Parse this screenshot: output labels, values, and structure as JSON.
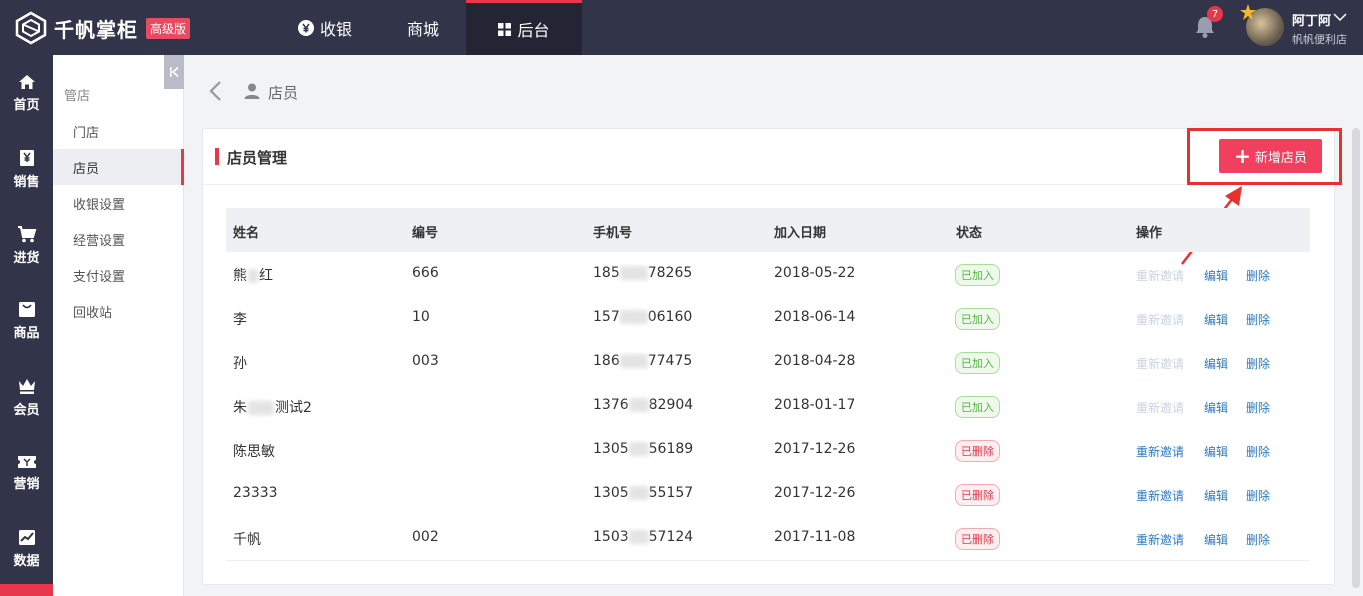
{
  "app": {
    "name": "千帆掌柜",
    "edition_badge": "高级版"
  },
  "topnav": [
    {
      "label": "收银",
      "icon": "yen-coin-icon"
    },
    {
      "label": "商城",
      "icon": ""
    },
    {
      "label": "后台",
      "icon": "grid-icon",
      "active": true
    }
  ],
  "header": {
    "notification_count": "7",
    "user_name": "阿丁阿",
    "store_name": "帆帆便利店"
  },
  "leftnav": [
    {
      "label": "首页",
      "icon": "home-icon"
    },
    {
      "label": "销售",
      "icon": "sales-receipt-icon"
    },
    {
      "label": "进货",
      "icon": "cart-icon"
    },
    {
      "label": "商品",
      "icon": "goods-box-icon"
    },
    {
      "label": "会员",
      "icon": "crown-icon"
    },
    {
      "label": "营销",
      "icon": "ticket-icon"
    },
    {
      "label": "数据",
      "icon": "chart-icon"
    }
  ],
  "subnav": {
    "title": "管店",
    "items": [
      {
        "label": "门店"
      },
      {
        "label": "店员",
        "active": true
      },
      {
        "label": "收银设置"
      },
      {
        "label": "经营设置"
      },
      {
        "label": "支付设置"
      },
      {
        "label": "回收站"
      }
    ]
  },
  "breadcrumb": {
    "label": "店员"
  },
  "card": {
    "title": "店员管理",
    "add_button": "新增店员"
  },
  "table": {
    "columns": [
      "姓名",
      "编号",
      "手机号",
      "加入日期",
      "状态",
      "操作"
    ],
    "rows": [
      {
        "name_pre": "熊",
        "name_post": "红",
        "id": "666",
        "phone_pre": "185",
        "phone_post": "78265",
        "date": "2018-05-22",
        "status": "已加入",
        "status_type": "ok",
        "actions": [
          "重新邀请",
          "编辑",
          "删除"
        ],
        "reinvite_enabled": false
      },
      {
        "name_pre": "李",
        "name_post": "",
        "id": "10",
        "phone_pre": "157",
        "phone_post": "06160",
        "date": "2018-06-14",
        "status": "已加入",
        "status_type": "ok",
        "actions": [
          "重新邀请",
          "编辑",
          "删除"
        ],
        "reinvite_enabled": false
      },
      {
        "name_pre": "孙",
        "name_post": "",
        "id": "003",
        "phone_pre": "186",
        "phone_post": "77475",
        "date": "2018-04-28",
        "status": "已加入",
        "status_type": "ok",
        "actions": [
          "重新邀请",
          "编辑",
          "删除"
        ],
        "reinvite_enabled": false
      },
      {
        "name_pre": "朱",
        "name_post": "测试2",
        "id": "",
        "phone_pre": "1376",
        "phone_post": "82904",
        "date": "2018-01-17",
        "status": "已加入",
        "status_type": "ok",
        "actions": [
          "重新邀请",
          "编辑",
          "删除"
        ],
        "reinvite_enabled": false
      },
      {
        "name_pre": "陈思敏",
        "name_post": "",
        "id": "",
        "phone_pre": "1305",
        "phone_post": "56189",
        "date": "2017-12-26",
        "status": "已删除",
        "status_type": "del",
        "actions": [
          "重新邀请",
          "编辑",
          "删除"
        ],
        "reinvite_enabled": true
      },
      {
        "name_pre": "23333",
        "name_post": "",
        "id": "",
        "phone_pre": "1305",
        "phone_post": "55157",
        "date": "2017-12-26",
        "status": "已删除",
        "status_type": "del",
        "actions": [
          "重新邀请",
          "编辑",
          "删除"
        ],
        "reinvite_enabled": true
      },
      {
        "name_pre": "千帆",
        "name_post": "",
        "id": "002",
        "phone_pre": "1503",
        "phone_post": "57124",
        "date": "2017-11-08",
        "status": "已删除",
        "status_type": "del",
        "actions": [
          "重新邀请",
          "编辑",
          "删除"
        ],
        "reinvite_enabled": true
      }
    ]
  },
  "colors": {
    "accent": "#f0405d",
    "nav_bg": "#323549",
    "link": "#2a7ac4",
    "annotation": "#e8312f"
  }
}
